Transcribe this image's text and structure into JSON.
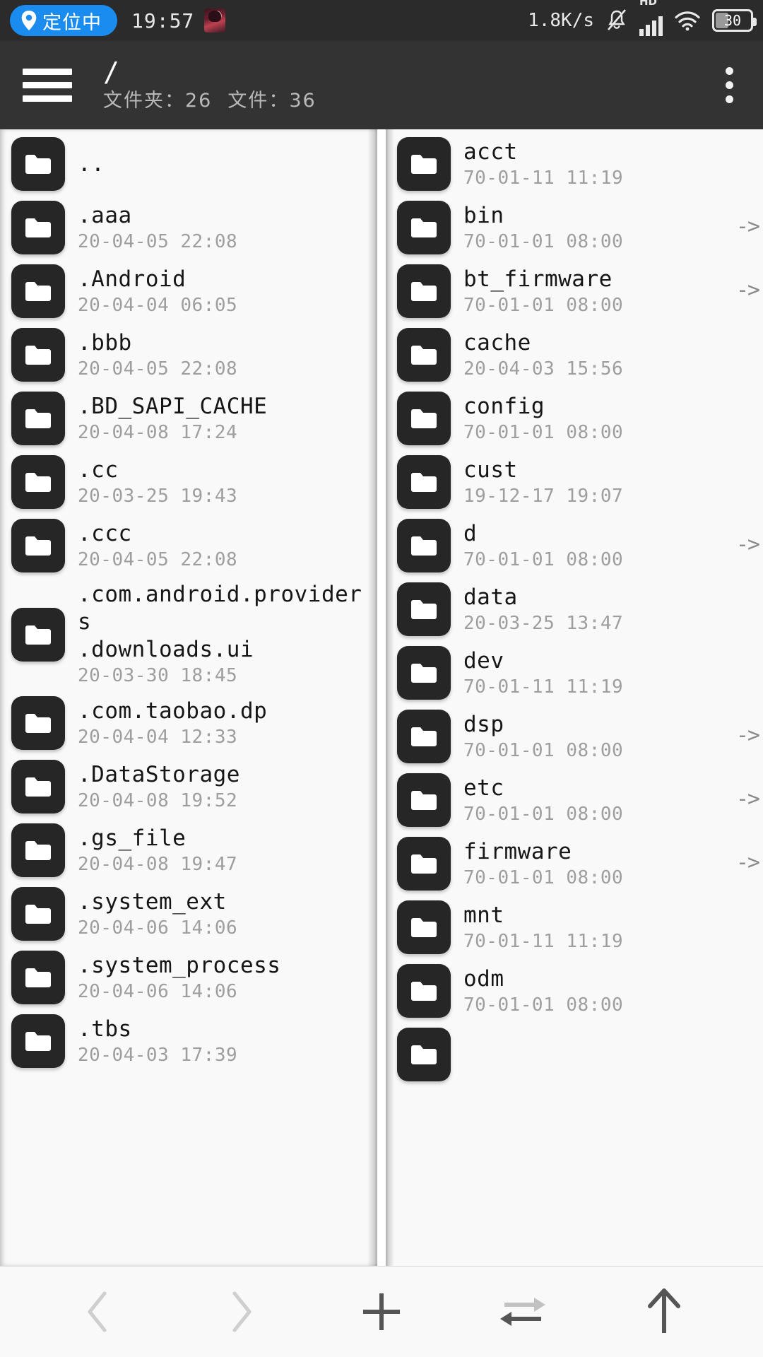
{
  "status_bar": {
    "location_label": "定位中",
    "location_icon": "location-pin-icon",
    "clock": "19:57",
    "avatar_icon": "app-avatar-icon",
    "net_speed": "1.8K/s",
    "mute_icon": "bell-muted-icon",
    "hd_label": "HD",
    "signal_icon": "cellular-signal-icon",
    "wifi_icon": "wifi-icon",
    "battery_level": "30",
    "accent_color": "#1a8cf0",
    "bar_background": "#2b2b2b"
  },
  "header": {
    "menu_icon": "hamburger-menu-icon",
    "path": "/",
    "folders_label": "文件夹：",
    "folders_count": "26",
    "files_label": "文件：",
    "files_count": "36",
    "overflow_icon": "more-vertical-icon",
    "background": "#333333"
  },
  "left_pane": {
    "rows": [
      {
        "name": "..",
        "date": "",
        "link": ""
      },
      {
        "name": ".aaa",
        "date": "20-04-05 22:08",
        "link": ""
      },
      {
        "name": ".Android",
        "date": "20-04-04 06:05",
        "link": ""
      },
      {
        "name": ".bbb",
        "date": "20-04-05 22:08",
        "link": ""
      },
      {
        "name": ".BD_SAPI_CACHE",
        "date": "20-04-08 17:24",
        "link": ""
      },
      {
        "name": ".cc",
        "date": "20-03-25 19:43",
        "link": ""
      },
      {
        "name": ".ccc",
        "date": "20-04-05 22:08",
        "link": ""
      },
      {
        "name": ".com.android.providers\n.downloads.ui",
        "date": "20-03-30 18:45",
        "link": ""
      },
      {
        "name": ".com.taobao.dp",
        "date": "20-04-04 12:33",
        "link": ""
      },
      {
        "name": ".DataStorage",
        "date": "20-04-08 19:52",
        "link": ""
      },
      {
        "name": ".gs_file",
        "date": "20-04-08 19:47",
        "link": ""
      },
      {
        "name": ".system_ext",
        "date": "20-04-06 14:06",
        "link": ""
      },
      {
        "name": ".system_process",
        "date": "20-04-06 14:06",
        "link": ""
      },
      {
        "name": ".tbs",
        "date": "20-04-03 17:39",
        "link": ""
      }
    ]
  },
  "right_pane": {
    "rows": [
      {
        "name": "acct",
        "date": "70-01-11 11:19",
        "link": ""
      },
      {
        "name": "bin",
        "date": "70-01-01 08:00",
        "link": "->"
      },
      {
        "name": "bt_firmware",
        "date": "70-01-01 08:00",
        "link": "->"
      },
      {
        "name": "cache",
        "date": "20-04-03 15:56",
        "link": ""
      },
      {
        "name": "config",
        "date": "70-01-01 08:00",
        "link": ""
      },
      {
        "name": "cust",
        "date": "19-12-17 19:07",
        "link": ""
      },
      {
        "name": "d",
        "date": "70-01-01 08:00",
        "link": "->"
      },
      {
        "name": "data",
        "date": "20-03-25 13:47",
        "link": ""
      },
      {
        "name": "dev",
        "date": "70-01-11 11:19",
        "link": ""
      },
      {
        "name": "dsp",
        "date": "70-01-01 08:00",
        "link": "->"
      },
      {
        "name": "etc",
        "date": "70-01-01 08:00",
        "link": "->"
      },
      {
        "name": "firmware",
        "date": "70-01-01 08:00",
        "link": "->"
      },
      {
        "name": "mnt",
        "date": "70-01-11 11:19",
        "link": ""
      },
      {
        "name": "odm",
        "date": "70-01-01 08:00",
        "link": ""
      },
      {
        "name": "",
        "date": "",
        "link": ""
      }
    ]
  },
  "bottom_bar": {
    "buttons": [
      {
        "name": "back-button",
        "icon": "chevron-left-icon",
        "enabled": false
      },
      {
        "name": "forward-button",
        "icon": "chevron-right-icon",
        "enabled": false
      },
      {
        "name": "add-button",
        "icon": "plus-icon",
        "enabled": true
      },
      {
        "name": "swap-panes-button",
        "icon": "swap-arrows-icon",
        "enabled": true
      },
      {
        "name": "up-button",
        "icon": "arrow-up-icon",
        "enabled": true
      }
    ]
  }
}
